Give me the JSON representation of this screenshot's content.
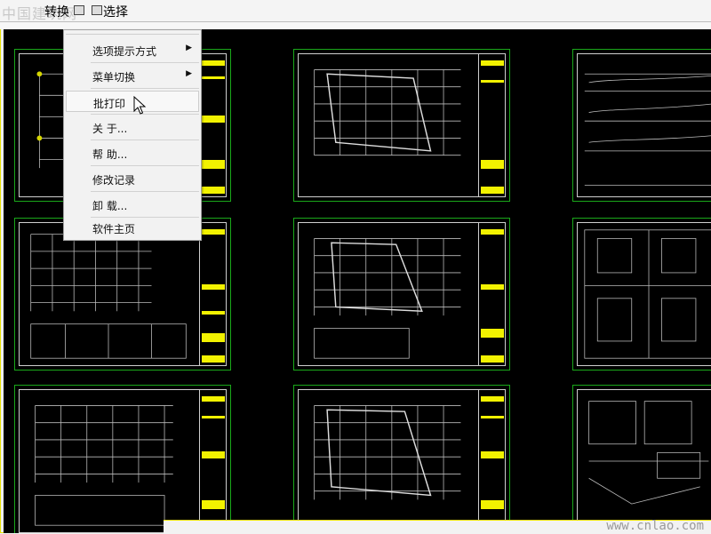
{
  "menubar": {
    "watermark_text": "中国建筑网",
    "tools_label": "转换",
    "select_label": "选择"
  },
  "context_menu": {
    "items": [
      {
        "label": "选项提示方式",
        "submenu": true
      },
      {
        "label": "菜单切换",
        "submenu": true
      },
      {
        "label": "批打印",
        "submenu": false,
        "hovered": true
      },
      {
        "label": "关 于...",
        "submenu": false
      },
      {
        "label": "帮 助...",
        "submenu": false
      },
      {
        "label": "修改记录",
        "submenu": false
      },
      {
        "label": "卸 载...",
        "submenu": false
      },
      {
        "label": "软件主页",
        "submenu": false
      }
    ],
    "submenu_arrow": "▶"
  },
  "status": {
    "site_watermark": "www.cnlao.com"
  },
  "colors": {
    "canvas": "#000000",
    "sheet_border": "#1aa81a",
    "title_block": "#f2f200",
    "frame_accent": "#e8e000"
  }
}
